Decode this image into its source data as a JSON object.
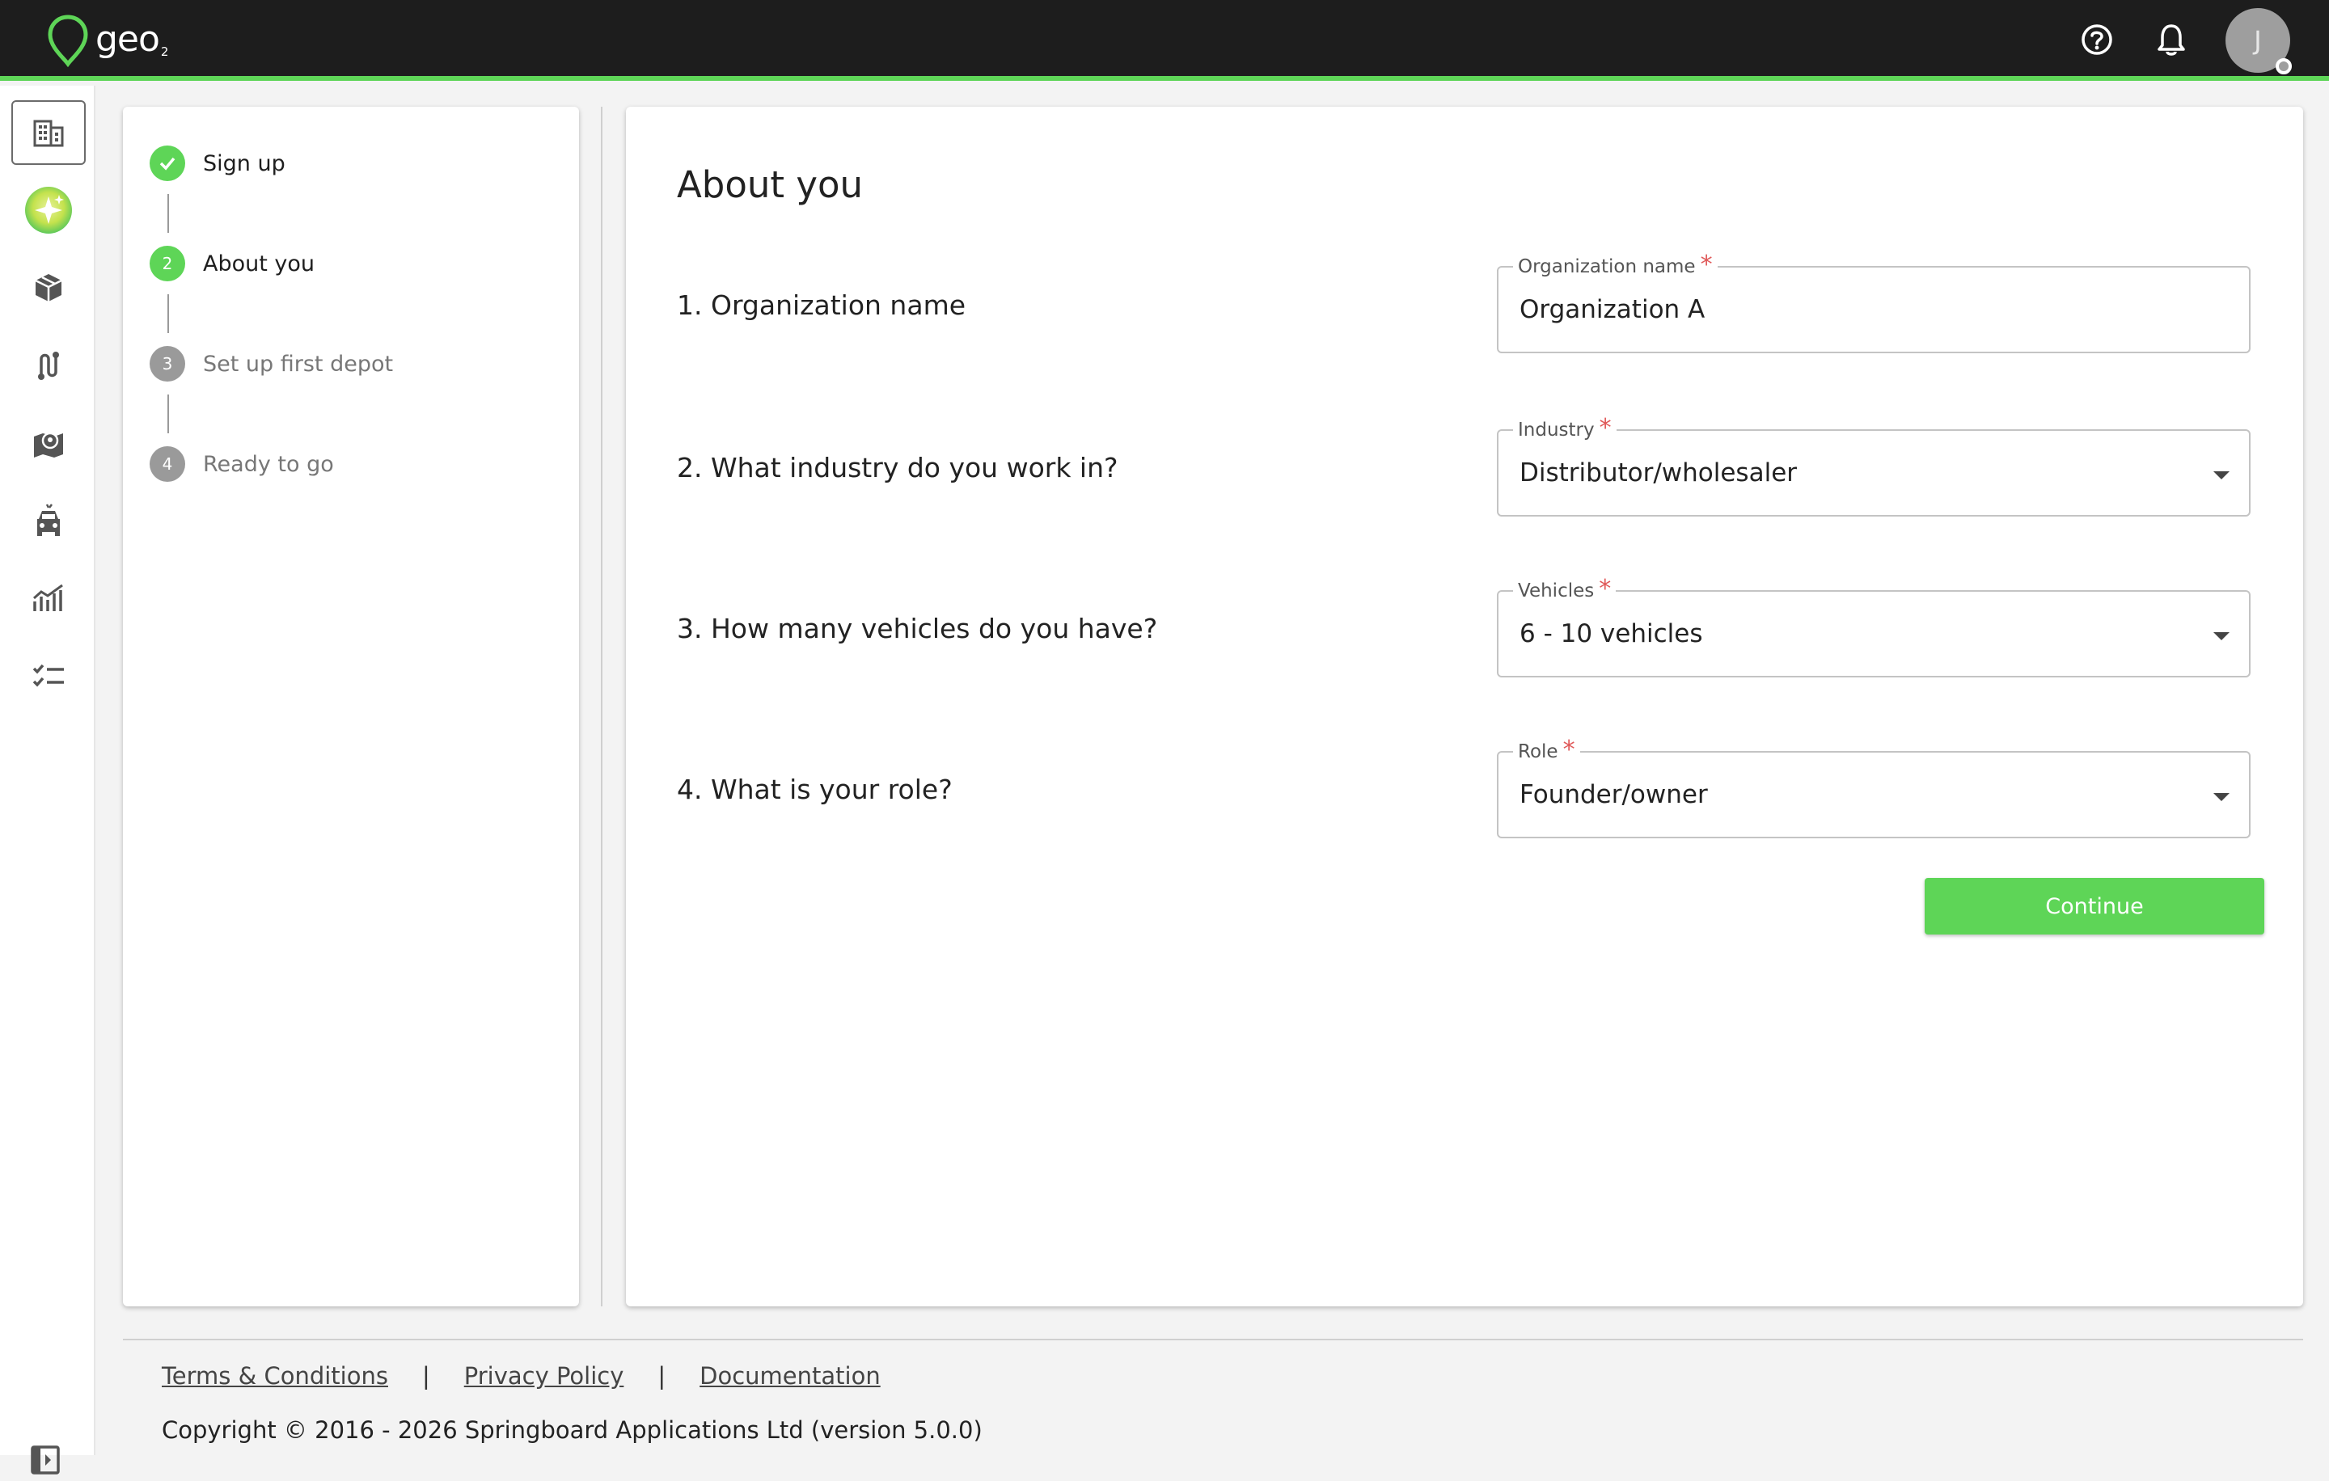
{
  "brand": {
    "name": "geo",
    "suffix": "2",
    "accent": "#5ed557"
  },
  "header": {
    "help_icon": "help-circle-icon",
    "notifications_icon": "bell-icon",
    "avatar_initial": "J"
  },
  "sidebar": {
    "items": [
      {
        "icon": "building-icon",
        "active": true
      },
      {
        "icon": "sparkle-icon"
      },
      {
        "icon": "package-icon"
      },
      {
        "icon": "route-icon"
      },
      {
        "icon": "map-pin-icon"
      },
      {
        "icon": "vehicle-icon"
      },
      {
        "icon": "analytics-icon"
      },
      {
        "icon": "checklist-icon"
      }
    ],
    "collapse_icon": "expand-sidebar-icon"
  },
  "stepper": {
    "steps": [
      {
        "number": "",
        "label": "Sign up",
        "state": "completed"
      },
      {
        "number": "2",
        "label": "About you",
        "state": "active"
      },
      {
        "number": "3",
        "label": "Set up first depot",
        "state": "pending"
      },
      {
        "number": "4",
        "label": "Ready to go",
        "state": "pending"
      }
    ]
  },
  "form": {
    "title": "About you",
    "questions": [
      {
        "label": "1. Organization name",
        "field_label": "Organization name",
        "value": "Organization A",
        "type": "text"
      },
      {
        "label": "2. What industry do you work in?",
        "field_label": "Industry",
        "value": "Distributor/wholesaler",
        "type": "select"
      },
      {
        "label": "3. How many vehicles do you have?",
        "field_label": "Vehicles",
        "value": "6 - 10 vehicles",
        "type": "select"
      },
      {
        "label": "4. What is your role?",
        "field_label": "Role",
        "value": "Founder/owner",
        "type": "select"
      }
    ],
    "required_mark": "*",
    "continue_label": "Continue"
  },
  "footer": {
    "links": [
      "Terms & Conditions",
      "Privacy Policy",
      "Documentation"
    ],
    "separator": "|",
    "copyright": "Copyright © 2016 - 2026 Springboard Applications Ltd (version 5.0.0)"
  }
}
